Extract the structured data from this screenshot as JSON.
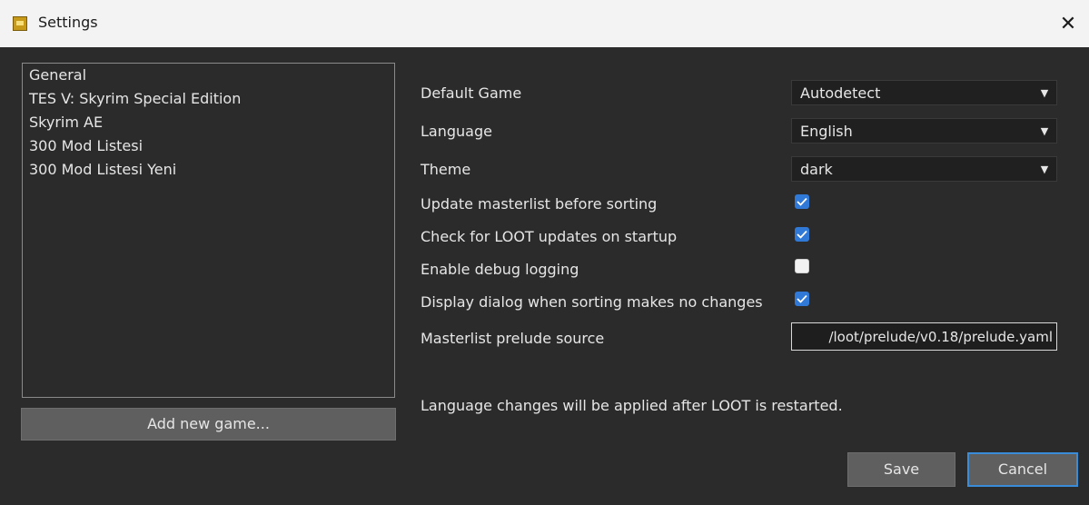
{
  "window": {
    "title": "Settings",
    "close_glyph": "✕",
    "app_icon": "loot-app-icon"
  },
  "games": [
    "General",
    "TES V: Skyrim Special Edition",
    "Skyrim AE",
    "300 Mod Listesi",
    "300 Mod Listesi Yeni"
  ],
  "add_game_label": "Add new game...",
  "settings": {
    "default_game": {
      "label": "Default Game",
      "value": "Autodetect"
    },
    "language": {
      "label": "Language",
      "value": "English"
    },
    "theme": {
      "label": "Theme",
      "value": "dark"
    },
    "update_masterlist": {
      "label": "Update masterlist before sorting",
      "checked": true
    },
    "check_updates": {
      "label": "Check for LOOT updates on startup",
      "checked": true
    },
    "debug_logging": {
      "label": "Enable debug logging",
      "checked": false
    },
    "sort_no_change_dialog": {
      "label": "Display dialog when sorting makes no changes",
      "checked": true
    },
    "prelude_source": {
      "label": "Masterlist prelude source",
      "value": "/loot/prelude/v0.18/prelude.yaml"
    }
  },
  "note": "Language changes will be applied after LOOT is restarted.",
  "buttons": {
    "save": "Save",
    "cancel": "Cancel"
  },
  "colors": {
    "accent": "#3079d6",
    "background": "#2b2b2b"
  }
}
